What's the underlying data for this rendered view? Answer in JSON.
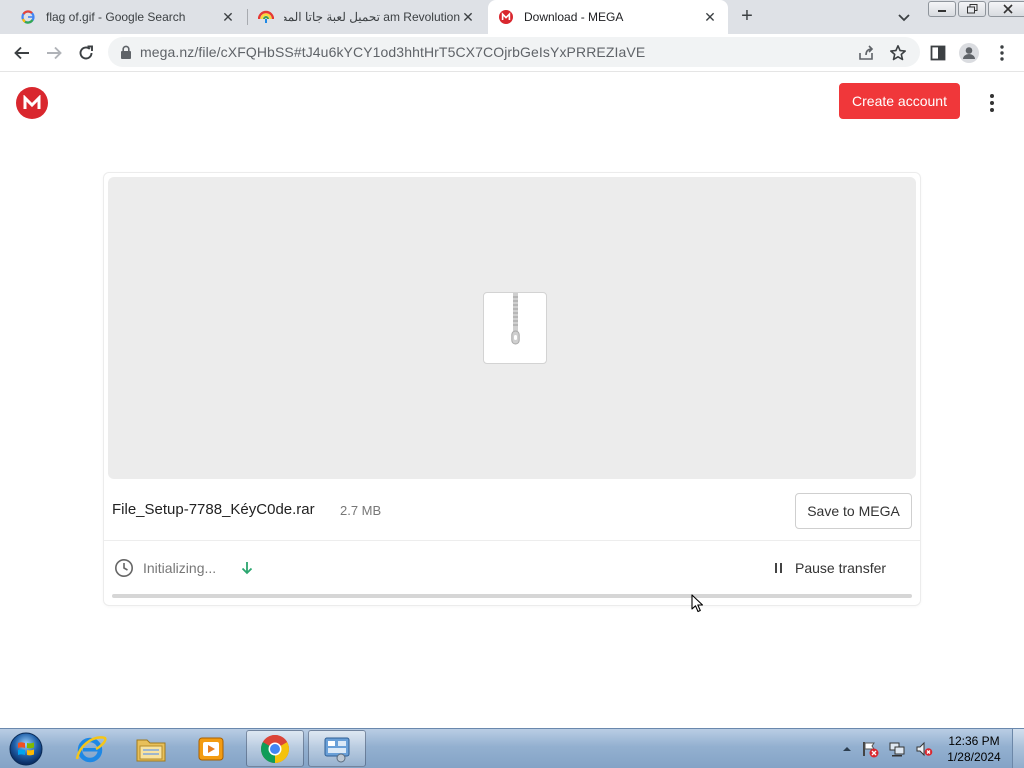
{
  "browser": {
    "tabs": [
      {
        "title": "flag of.gif - Google Search",
        "icon": "google-icon",
        "active": false
      },
      {
        "title": "تحميل لعبة جاتا المصرية Game Revolution",
        "title_visible": "am Revolution تحميل لعبة جاتا المصرية",
        "icon": "game-revolution-icon",
        "active": false
      },
      {
        "title": "Download - MEGA",
        "icon": "mega-icon",
        "active": true
      }
    ],
    "new_tab_label": "+",
    "url": "mega.nz/file/cXFQHbSS#tJ4u6kYCY1od3hhtHrT5CX7COjrbGeIsYxPRREZIaVE"
  },
  "mega": {
    "logo_letter": "M",
    "create_account_label": "Create account",
    "file": {
      "name": "File_Setup-7788_KéyC0de.rar",
      "size": "2.7 MB",
      "type_icon": "zip-archive-icon"
    },
    "save_label": "Save to MEGA",
    "status_text": "Initializing...",
    "pause_label": "Pause transfer",
    "progress_fraction": 0
  },
  "colors": {
    "mega_red": "#d9272e",
    "create_button": "#f0373a",
    "progress_track": "#d6d6d6",
    "download_arrow": "#2ba66f"
  },
  "taskbar": {
    "apps": [
      "start-orb",
      "internet-explorer-icon",
      "windows-explorer-icon",
      "media-player-icon",
      "chrome-icon",
      "control-panel-icon"
    ],
    "clock_time": "12:36 PM",
    "clock_date": "1/28/2024"
  }
}
